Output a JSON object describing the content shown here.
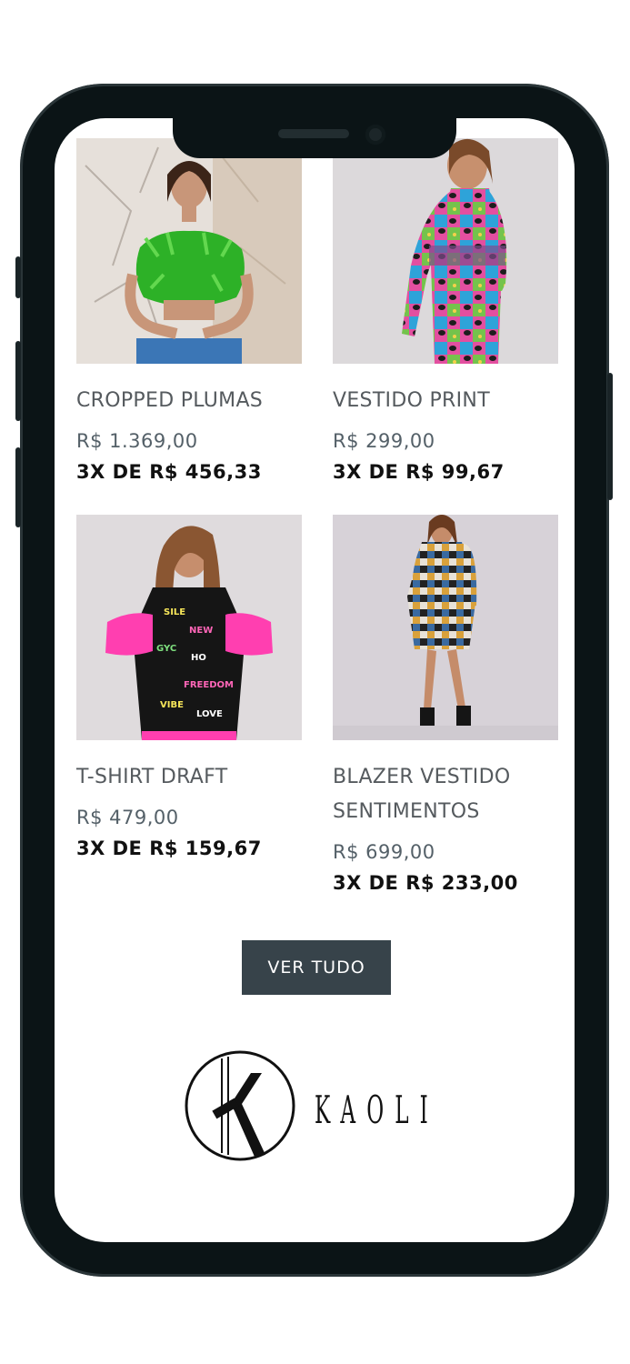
{
  "products": [
    {
      "name": "CROPPED PLUMAS",
      "price": "R$ 1.369,00",
      "installments": "3X DE R$ 456,33"
    },
    {
      "name": "VESTIDO PRINT",
      "price": "R$ 299,00",
      "installments": "3X DE R$ 99,67"
    },
    {
      "name": "T-SHIRT DRAFT",
      "price": "R$ 479,00",
      "installments": "3X DE R$ 159,67"
    },
    {
      "name": "BLAZER VESTIDO SENTIMENTOS",
      "price": "R$ 699,00",
      "installments": "3X DE R$ 233,00"
    }
  ],
  "cta": {
    "label": "VER TUDO"
  },
  "brand": {
    "wordmark": "KAOLI"
  },
  "colors": {
    "price": "#546068",
    "button_bg": "#37434a",
    "phone_frame": "#0b1416"
  }
}
